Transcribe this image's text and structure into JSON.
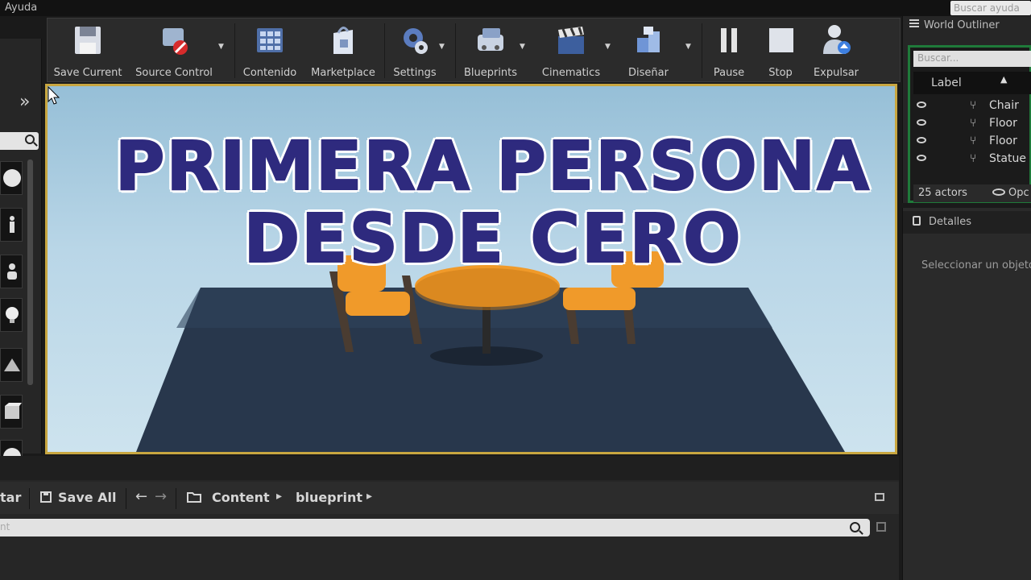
{
  "menu": {
    "help": "Ayuda",
    "search_placeholder": "Buscar ayuda"
  },
  "toolbar": {
    "buttons": [
      {
        "label": "Save Current",
        "icon": "floppy-disk-icon",
        "dropdown": false
      },
      {
        "label": "Source Control",
        "icon": "source-control-icon",
        "dropdown": true
      },
      {
        "label": "Contenido",
        "icon": "content-grid-icon",
        "dropdown": false
      },
      {
        "label": "Marketplace",
        "icon": "marketplace-bag-icon",
        "dropdown": false
      },
      {
        "label": "Settings",
        "icon": "settings-gears-icon",
        "dropdown": true
      },
      {
        "label": "Blueprints",
        "icon": "blueprints-icon",
        "dropdown": true
      },
      {
        "label": "Cinematics",
        "icon": "clapperboard-icon",
        "dropdown": true
      },
      {
        "label": "Diseñar",
        "icon": "build-cubes-icon",
        "dropdown": true
      },
      {
        "label": "Pause",
        "icon": "pause-icon",
        "dropdown": false
      },
      {
        "label": "Stop",
        "icon": "stop-icon",
        "dropdown": false
      },
      {
        "label": "Expulsar",
        "icon": "eject-person-icon",
        "dropdown": false
      }
    ]
  },
  "viewport": {
    "overlay_line1": "PRIMERA PERSONA",
    "overlay_line2": "DESDE CERO"
  },
  "outliner": {
    "tab": "World Outliner",
    "search_placeholder": "Buscar...",
    "column_label": "Label",
    "rows": [
      "Chair",
      "Floor",
      "Floor",
      "Statue"
    ],
    "actor_count": "25 actors",
    "view_options": "Opc"
  },
  "details": {
    "tab": "Detalles",
    "hint": "Seleccionar un objeto"
  },
  "content_browser": {
    "import_partial": "tar",
    "save_all": "Save All",
    "path": [
      "Content",
      "blueprint"
    ],
    "filter_placeholder": "nt"
  },
  "colors": {
    "overlay_text": "#2e2a7e",
    "viewport_border": "#c8a640",
    "outliner_border": "#1f7a3a",
    "chair_orange": "#f09a2a"
  }
}
